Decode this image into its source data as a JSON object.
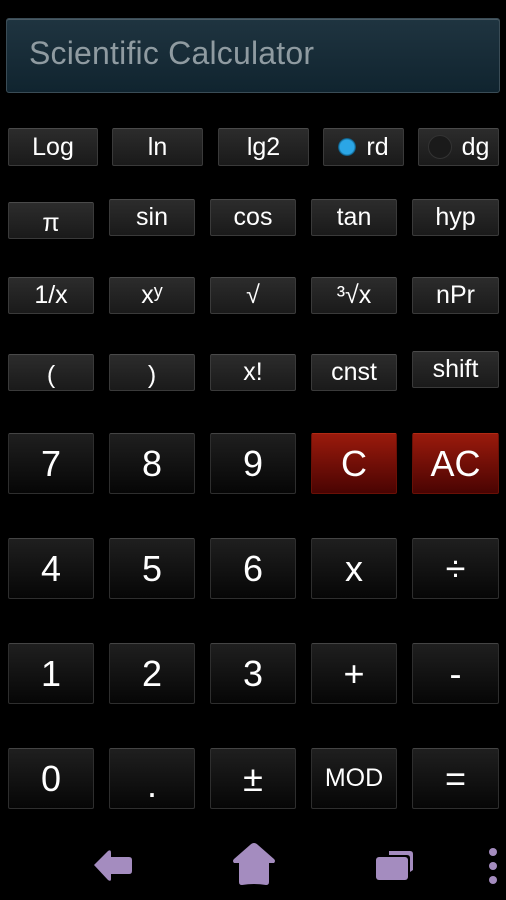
{
  "display": {
    "text": "Scientific Calculator"
  },
  "function_rows": [
    [
      {
        "label": "Log"
      },
      {
        "label": "ln"
      },
      {
        "label": "lg2"
      },
      {
        "label": "rd",
        "radio": true,
        "selected": true
      },
      {
        "label": "dg",
        "radio": true,
        "selected": false
      }
    ],
    [
      {
        "label": "π"
      },
      {
        "label": "sin"
      },
      {
        "label": "cos"
      },
      {
        "label": "tan"
      },
      {
        "label": "hyp"
      }
    ],
    [
      {
        "label": "1/x"
      },
      {
        "label": "x",
        "sup": "y"
      },
      {
        "label": "√"
      },
      {
        "label": "³√x"
      },
      {
        "label": "nPr"
      }
    ],
    [
      {
        "label": "("
      },
      {
        "label": ")"
      },
      {
        "label": "x!"
      },
      {
        "label": "cnst"
      },
      {
        "label": "shift"
      }
    ]
  ],
  "keypad_rows": [
    [
      {
        "label": "7"
      },
      {
        "label": "8"
      },
      {
        "label": "9"
      },
      {
        "label": "C",
        "style": "red"
      },
      {
        "label": "AC",
        "style": "red"
      }
    ],
    [
      {
        "label": "4"
      },
      {
        "label": "5"
      },
      {
        "label": "6"
      },
      {
        "label": "x"
      },
      {
        "label": "÷"
      }
    ],
    [
      {
        "label": "1"
      },
      {
        "label": "2"
      },
      {
        "label": "3"
      },
      {
        "label": "+"
      },
      {
        "label": "-"
      }
    ],
    [
      {
        "label": "0"
      },
      {
        "label": "."
      },
      {
        "label": "±"
      },
      {
        "label": "MOD"
      },
      {
        "label": "="
      }
    ]
  ],
  "navbar": {
    "icons": [
      "back-icon",
      "home-icon",
      "recent-apps-icon",
      "menu-icon"
    ],
    "color": "#a48cbf"
  },
  "colors": {
    "accent_radio": "#2ba6e6",
    "clear_buttons": "#8a160a",
    "display_bg": "#1a2e39"
  }
}
